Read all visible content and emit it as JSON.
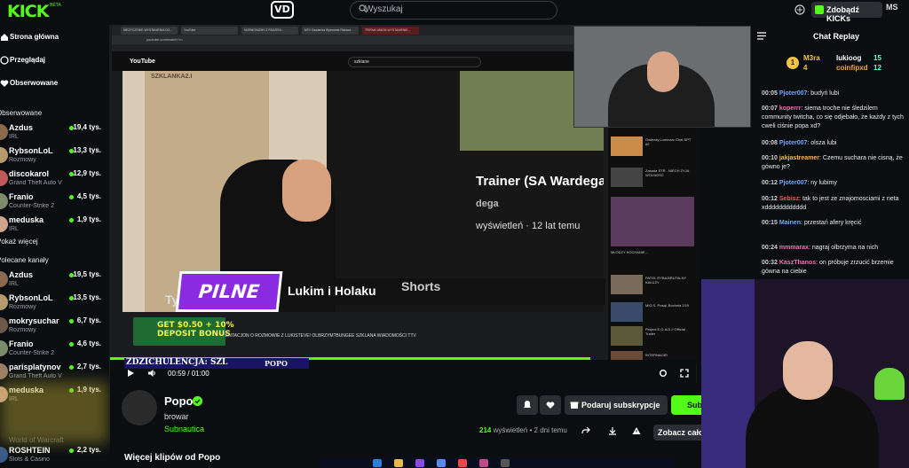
{
  "topbar": {
    "logo": "KICK",
    "logo_beta": "BETA",
    "search_placeholder": "Wyszukaj",
    "kicks_button": "Zdobądź KICKs",
    "user_initials": "MS"
  },
  "sidebar": {
    "nav": [
      {
        "label": "Strona główna",
        "icon": "home-icon"
      },
      {
        "label": "Przeglądaj",
        "icon": "compass-icon"
      },
      {
        "label": "Obserwowane",
        "icon": "heart-icon"
      }
    ],
    "followed_title": "Obserwowane",
    "followed": [
      {
        "name": "Azdus",
        "category": "IRL",
        "viewers": "19,4 tys."
      },
      {
        "name": "RybsonLoL",
        "category": "Rozmowy",
        "viewers": "13,3 tys."
      },
      {
        "name": "discokarol",
        "category": "Grand Theft Auto V",
        "viewers": "12,9 tys."
      },
      {
        "name": "Franio",
        "category": "Counter-Strike 2",
        "viewers": "4,5 tys."
      },
      {
        "name": "meduska",
        "category": "IRL",
        "viewers": "1,9 tys."
      }
    ],
    "show_more": "Pokaż więcej",
    "recommended_title": "Polecane kanały",
    "recommended": [
      {
        "name": "Azdus",
        "category": "IRL",
        "viewers": "19,5 tys."
      },
      {
        "name": "RybsonLoL",
        "category": "Rozmowy",
        "viewers": "13,5 tys."
      },
      {
        "name": "mokrysuchar",
        "category": "Rozmowy",
        "viewers": "6,7 tys."
      },
      {
        "name": "Franio",
        "category": "Counter-Strike 2",
        "viewers": "4,6 tys."
      },
      {
        "name": "parisplatynov",
        "category": "Grand Theft Auto V",
        "viewers": "2,7 tys."
      },
      {
        "name": "meduska",
        "category": "IRL",
        "viewers": "1,9 tys."
      },
      {
        "name": "ROSHTEIN",
        "category": "Slots & Casino",
        "viewers": "2,2 tys."
      }
    ],
    "world_of_warcraft": "World of Warcraft"
  },
  "player": {
    "browser_tabs": [
      "NIEZYCZENIE WYSTANIENIA DO...",
      "YouTube",
      "NORMONIZMY Z FADZENI...",
      "MTV Kawiarnia Wyzwanie Plakacz...",
      "TRIPAKI ANIEM WYSTANIENIE..."
    ],
    "address": "youtube.com/watch?v=",
    "yt_logo": "YouTube",
    "yt_search": "szklane",
    "video_wall_text": "SZKLANKA2.I",
    "video_title": "Trainer (SA Wardega",
    "video_channel": "dega",
    "video_views": "wyświetleń · 12 lat temu",
    "pilne": "PILNE",
    "lower_third": "Lukim i Holaku",
    "shorts": "Shorts",
    "tyl": "Ty",
    "bonus_line1": "GET $0.50 + 10%",
    "bonus_line2": "DEPOSIT BONUS",
    "ticker": "ENTACJON O ROZMOWIE Z LUKISTEVE! OLBRZYM?BUNGEE SZKLANA WIADOMOŚCI TTV",
    "zdz_label": "ZDZICHULENCJA: SZL",
    "popo_small": "POPO",
    "time": "00:59 / 01:00",
    "progress": 0.98,
    "recs": [
      "Gwiezdy Luminarz Chat SPT #2",
      "Zasada STR - NIECH ZYJA WOLNOŚĆ",
      "MŁODZY KOCHANIE...",
      "PATOL RYBA BRUTALNY KAŁUŻY",
      "MIG S. Posał, Bochnia 2/19",
      "Project E.G.A.D // Official Trailer",
      "INTERNACIE!"
    ]
  },
  "chat": {
    "title": "Chat Replay",
    "leaderboard": [
      {
        "name": "M3ra",
        "score": "4"
      },
      {
        "name": "lukioog",
        "score": "15"
      },
      {
        "name": "coinfipxd",
        "score": "12"
      }
    ],
    "messages": [
      {
        "time": "00:05",
        "user": "Pjoter007",
        "color": "#6fa8ff",
        "text": "budyń lubi"
      },
      {
        "time": "00:07",
        "user": "koperrr",
        "color": "#ff6ab3",
        "text": "siema troche nie śledzilem community twitcha, co się odjebało, że każdy z tych cweli ciśnie popa xd?"
      },
      {
        "time": "00:08",
        "user": "Pjoter007",
        "color": "#6fa8ff",
        "text": "olsza lubi"
      },
      {
        "time": "00:10",
        "user": "jakjastreamer",
        "color": "#ffb347",
        "text": "Czemu suchara nie cisną, że gówno je?"
      },
      {
        "time": "00:12",
        "user": "Pjoter007",
        "color": "#6fa8ff",
        "text": "ny lubimy"
      },
      {
        "time": "00:12",
        "user": "Sebisz",
        "color": "#ff4f4f",
        "text": "tak to jest ze znajomosciami z neta xdddddddddddd"
      },
      {
        "time": "00:15",
        "user": "Mainen",
        "color": "#6fa8ff",
        "text": "przestań afery kręcić"
      },
      {
        "time": "00:24",
        "user": "mmmarax",
        "color": "#ff6ab3",
        "text": "nagraj olbrzyma na nich"
      },
      {
        "time": "00:32",
        "user": "KaszThanos",
        "color": "#ff6ab3",
        "text": "on próbuje zrzucić brzemie gówna na ciebie"
      }
    ]
  },
  "channel": {
    "name": "Popo",
    "subtitle": "browar",
    "category": "Subnautica",
    "views": "214",
    "views_rest": "wyświetleń • 2 dni temu",
    "gift_sub": "Podaruj subskrypcje",
    "subscribe": "Subskrybuj",
    "see_all": "Zobacz całość",
    "more_clips": "Więcej klipów od Popo"
  },
  "colors": {
    "accent": "#53fc18",
    "background": "#0b0e11"
  }
}
